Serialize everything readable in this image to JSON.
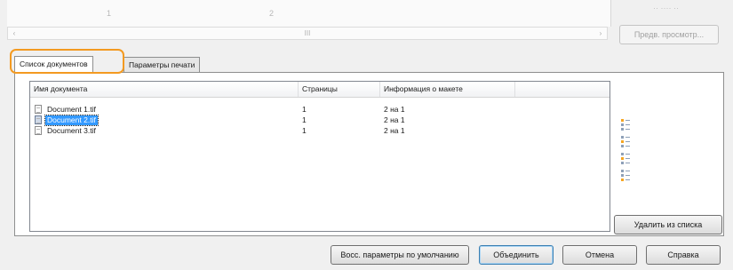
{
  "top": {
    "faint_mark_1": "1",
    "faint_mark_2": "2",
    "faint_right": "·· ···· ··",
    "scroll_left": "‹",
    "scroll_thumb": "III",
    "scroll_right": "›",
    "preview_button": "Предв. просмотр..."
  },
  "tabs": [
    {
      "label": "Список документов",
      "active": true
    },
    {
      "label": "Параметры печати",
      "active": false
    }
  ],
  "list": {
    "columns": [
      "Имя документа",
      "Страницы",
      "Информация о макете"
    ],
    "rows": [
      {
        "name": "Document 1.tif",
        "pages": "1",
        "layout": "2 на 1",
        "selected": false
      },
      {
        "name": "Document 2.tif",
        "pages": "1",
        "layout": "2 на 1",
        "selected": true
      },
      {
        "name": "Document 3.tif",
        "pages": "1",
        "layout": "2 на 1",
        "selected": false
      }
    ]
  },
  "side": {
    "order_icons": [
      "move-top-icon",
      "move-up-icon",
      "move-down-icon",
      "move-bottom-icon"
    ],
    "remove_button": "Удалить из списка"
  },
  "footer": {
    "reset_button": "Восс. параметры по умолчанию",
    "merge_button": "Объединить",
    "cancel_button": "Отмена",
    "help_button": "Справка"
  },
  "colors": {
    "highlight": "#f39a21",
    "selection": "#3399ff",
    "order_icon_accent": "#f5a623"
  }
}
